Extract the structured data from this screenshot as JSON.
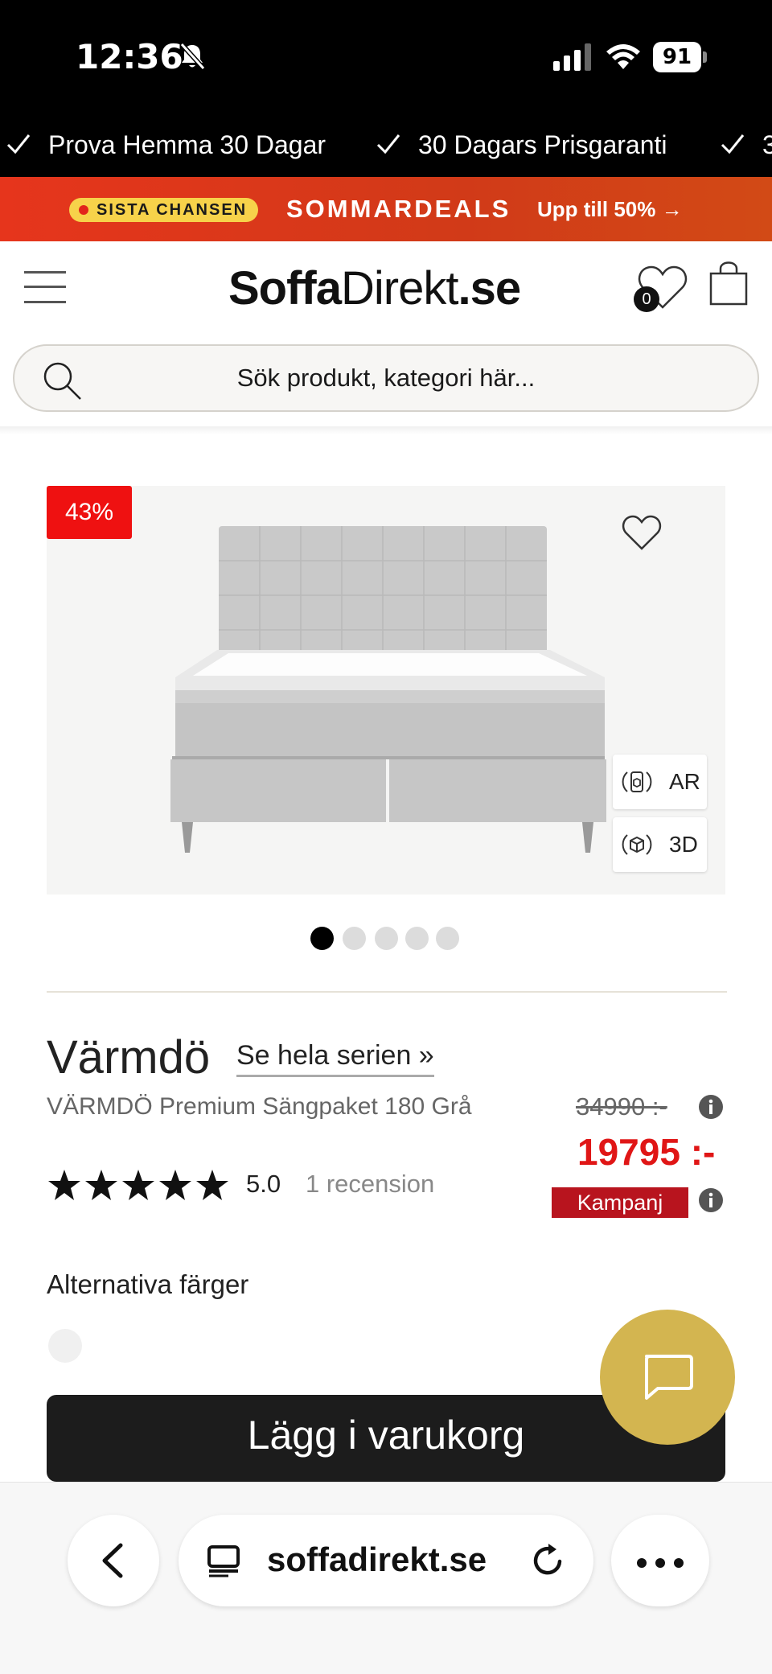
{
  "status_bar": {
    "time": "12:36",
    "battery": "91"
  },
  "usp": {
    "items": [
      "Prova Hemma 30 Dagar",
      "30 Dagars Prisgaranti",
      "3"
    ]
  },
  "promo": {
    "pill": "SISTA CHANSEN",
    "title": "SOMMARDEALS",
    "subtitle": "Upp till 50% →"
  },
  "header": {
    "logo_bold": "Soffa",
    "logo_regular": "Direkt",
    "logo_suffix": ".se",
    "wishlist_count": "0"
  },
  "search": {
    "placeholder": "Sök produkt, kategori här..."
  },
  "gallery": {
    "discount_badge": "43%",
    "ar_label": "AR",
    "threed_label": "3D",
    "image_count": 5,
    "active_image": 1
  },
  "product": {
    "name": "Värmdö",
    "series_link": "Se hela serien »",
    "description": "VÄRMDÖ Premium Sängpaket 180 Grå",
    "rating_value": "5.0",
    "stars": 5,
    "reviews": "1 recension",
    "old_price": "34990 :-",
    "new_price": "19795 :-",
    "campaign_label": "Kampanj",
    "alt_colors_label": "Alternativa färger",
    "add_to_cart": "Lägg i varukorg"
  },
  "browser": {
    "url": "soffadirekt.se"
  },
  "colors": {
    "promo_bg": "#e6351c",
    "pill_bg": "#f7d24a",
    "badge_red": "#ef1111",
    "price_red": "#e01616",
    "campaign_bg": "#b8141e",
    "chat_gold": "#d3b550"
  }
}
